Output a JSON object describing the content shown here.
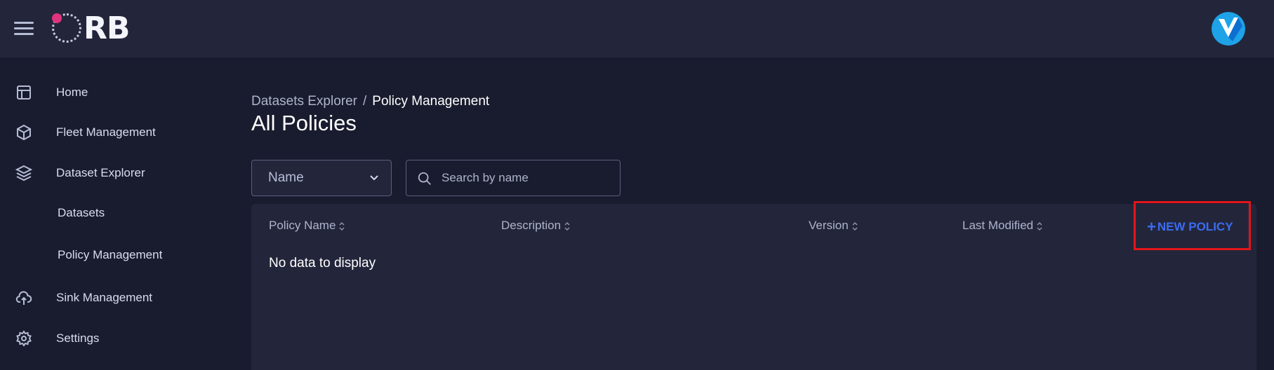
{
  "header": {
    "logo_text": "RB",
    "colors": {
      "topbar": "#23263b",
      "logo_dot": "#e0337e",
      "avatar": "#1ea2e8"
    }
  },
  "sidebar": {
    "items": [
      {
        "label": "Home",
        "icon": "layout-icon"
      },
      {
        "label": "Fleet Management",
        "icon": "cube-icon"
      },
      {
        "label": "Dataset Explorer",
        "icon": "layers-icon"
      },
      {
        "label": "Datasets",
        "icon": ""
      },
      {
        "label": "Policy Management",
        "icon": ""
      },
      {
        "label": "Sink Management",
        "icon": "cloud-upload-icon"
      },
      {
        "label": "Settings",
        "icon": "gear-icon"
      }
    ]
  },
  "breadcrumb": {
    "parent": "Datasets Explorer",
    "separator": "/",
    "current": "Policy Management"
  },
  "page_title": "All Policies",
  "filter": {
    "selected": "Name"
  },
  "search": {
    "placeholder": "Search by name",
    "value": ""
  },
  "table": {
    "columns": [
      "Policy Name",
      "Description",
      "Version",
      "Last Modified"
    ],
    "empty_text": "No data to display"
  },
  "actions": {
    "new_policy_label": "NEW POLICY",
    "accent": "#3a6cf0",
    "highlight": "#e3151a"
  }
}
